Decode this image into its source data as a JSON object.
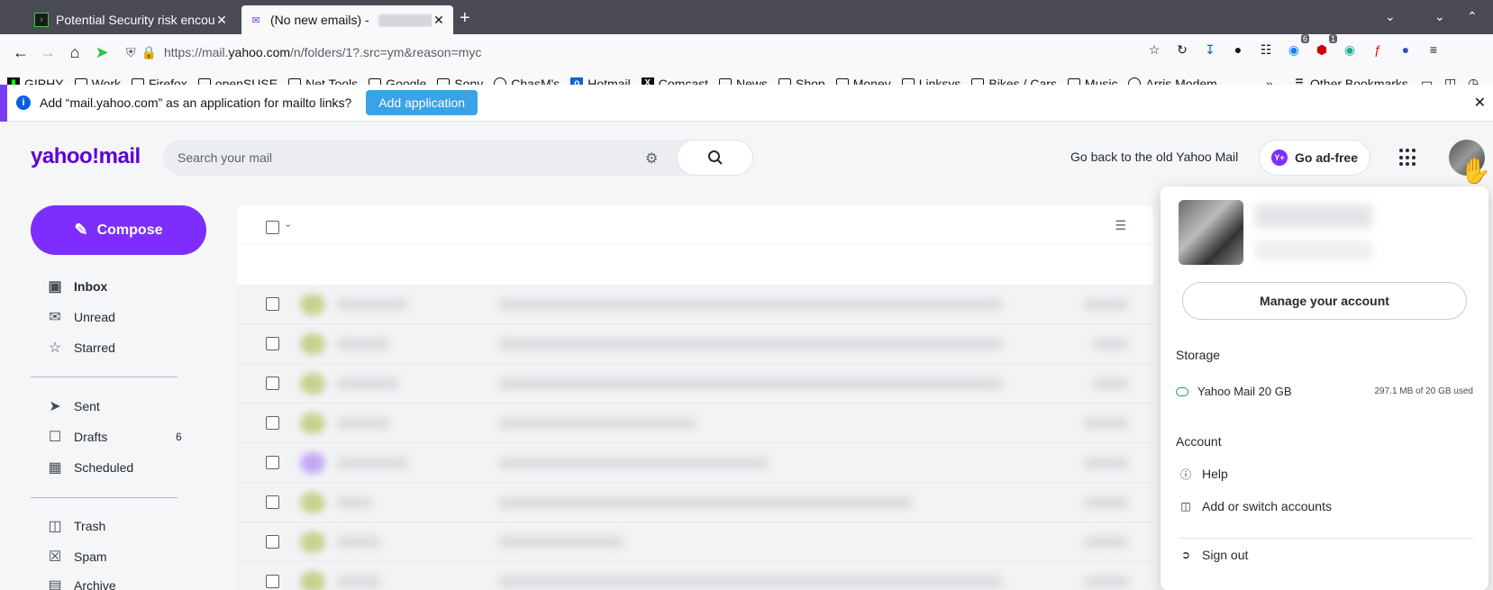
{
  "browser": {
    "tabs": [
      {
        "title": "Potential Security risk encou",
        "active": false
      },
      {
        "title": "(No new emails) - ",
        "active": true
      }
    ],
    "url_prefix": "https://mail.",
    "url_host": "yahoo.com",
    "url_path": "/n/folders/1?.src=ym&reason=myc",
    "toolbar_badges": {
      "extension_count": "6",
      "adblock_count": "1"
    },
    "bookmarks": [
      {
        "label": "GIPHY",
        "icon": "giphy-icon"
      },
      {
        "label": "Work",
        "icon": "folder-icon"
      },
      {
        "label": "Firefox",
        "icon": "folder-icon"
      },
      {
        "label": "openSUSE",
        "icon": "folder-icon"
      },
      {
        "label": "Net Tools",
        "icon": "folder-icon"
      },
      {
        "label": "Google",
        "icon": "folder-icon"
      },
      {
        "label": "Sony",
        "icon": "folder-icon"
      },
      {
        "label": "ChasM's",
        "icon": "globe-icon"
      },
      {
        "label": "Hotmail",
        "icon": "outlook-icon"
      },
      {
        "label": "Comcast",
        "icon": "x-icon"
      },
      {
        "label": "News",
        "icon": "folder-icon"
      },
      {
        "label": "Shop",
        "icon": "folder-icon"
      },
      {
        "label": "Money",
        "icon": "folder-icon"
      },
      {
        "label": "Linksys",
        "icon": "folder-icon"
      },
      {
        "label": "Bikes / Cars",
        "icon": "folder-icon"
      },
      {
        "label": "Music",
        "icon": "folder-icon"
      },
      {
        "label": "Arris Modem",
        "icon": "globe-icon"
      }
    ],
    "other_bookmarks": "Other Bookmarks",
    "notification": {
      "message": "Add “mail.yahoo.com” as an application for mailto links?",
      "button": "Add application"
    }
  },
  "yahoo": {
    "logo": "yahoo!mail",
    "search_placeholder": "Search your mail",
    "old_mail_link": "Go back to the old Yahoo Mail",
    "ad_free": "Go ad-free",
    "compose": "Compose",
    "nav": [
      {
        "label": "Inbox",
        "icon": "inbox-icon",
        "active": true
      },
      {
        "label": "Unread",
        "icon": "envelope-icon"
      },
      {
        "label": "Starred",
        "icon": "star-icon"
      },
      {
        "label": "Sent",
        "icon": "send-icon"
      },
      {
        "label": "Drafts",
        "icon": "draft-icon",
        "count": "6"
      },
      {
        "label": "Scheduled",
        "icon": "calendar-icon"
      },
      {
        "label": "Trash",
        "icon": "trash-icon"
      },
      {
        "label": "Spam",
        "icon": "spam-icon"
      },
      {
        "label": "Archive",
        "icon": "archive-icon"
      }
    ]
  },
  "account_menu": {
    "manage": "Manage your account",
    "storage_heading": "Storage",
    "storage_plan": "Yahoo Mail 20 GB",
    "storage_used": "297.1 MB of 20 GB used",
    "account_heading": "Account",
    "help": "Help",
    "switch": "Add or switch accounts",
    "sign_out": "Sign out"
  },
  "colors": {
    "brand_purple": "#6001d2",
    "compose": "#7d2eff",
    "notification_button": "#3aa2e8"
  }
}
